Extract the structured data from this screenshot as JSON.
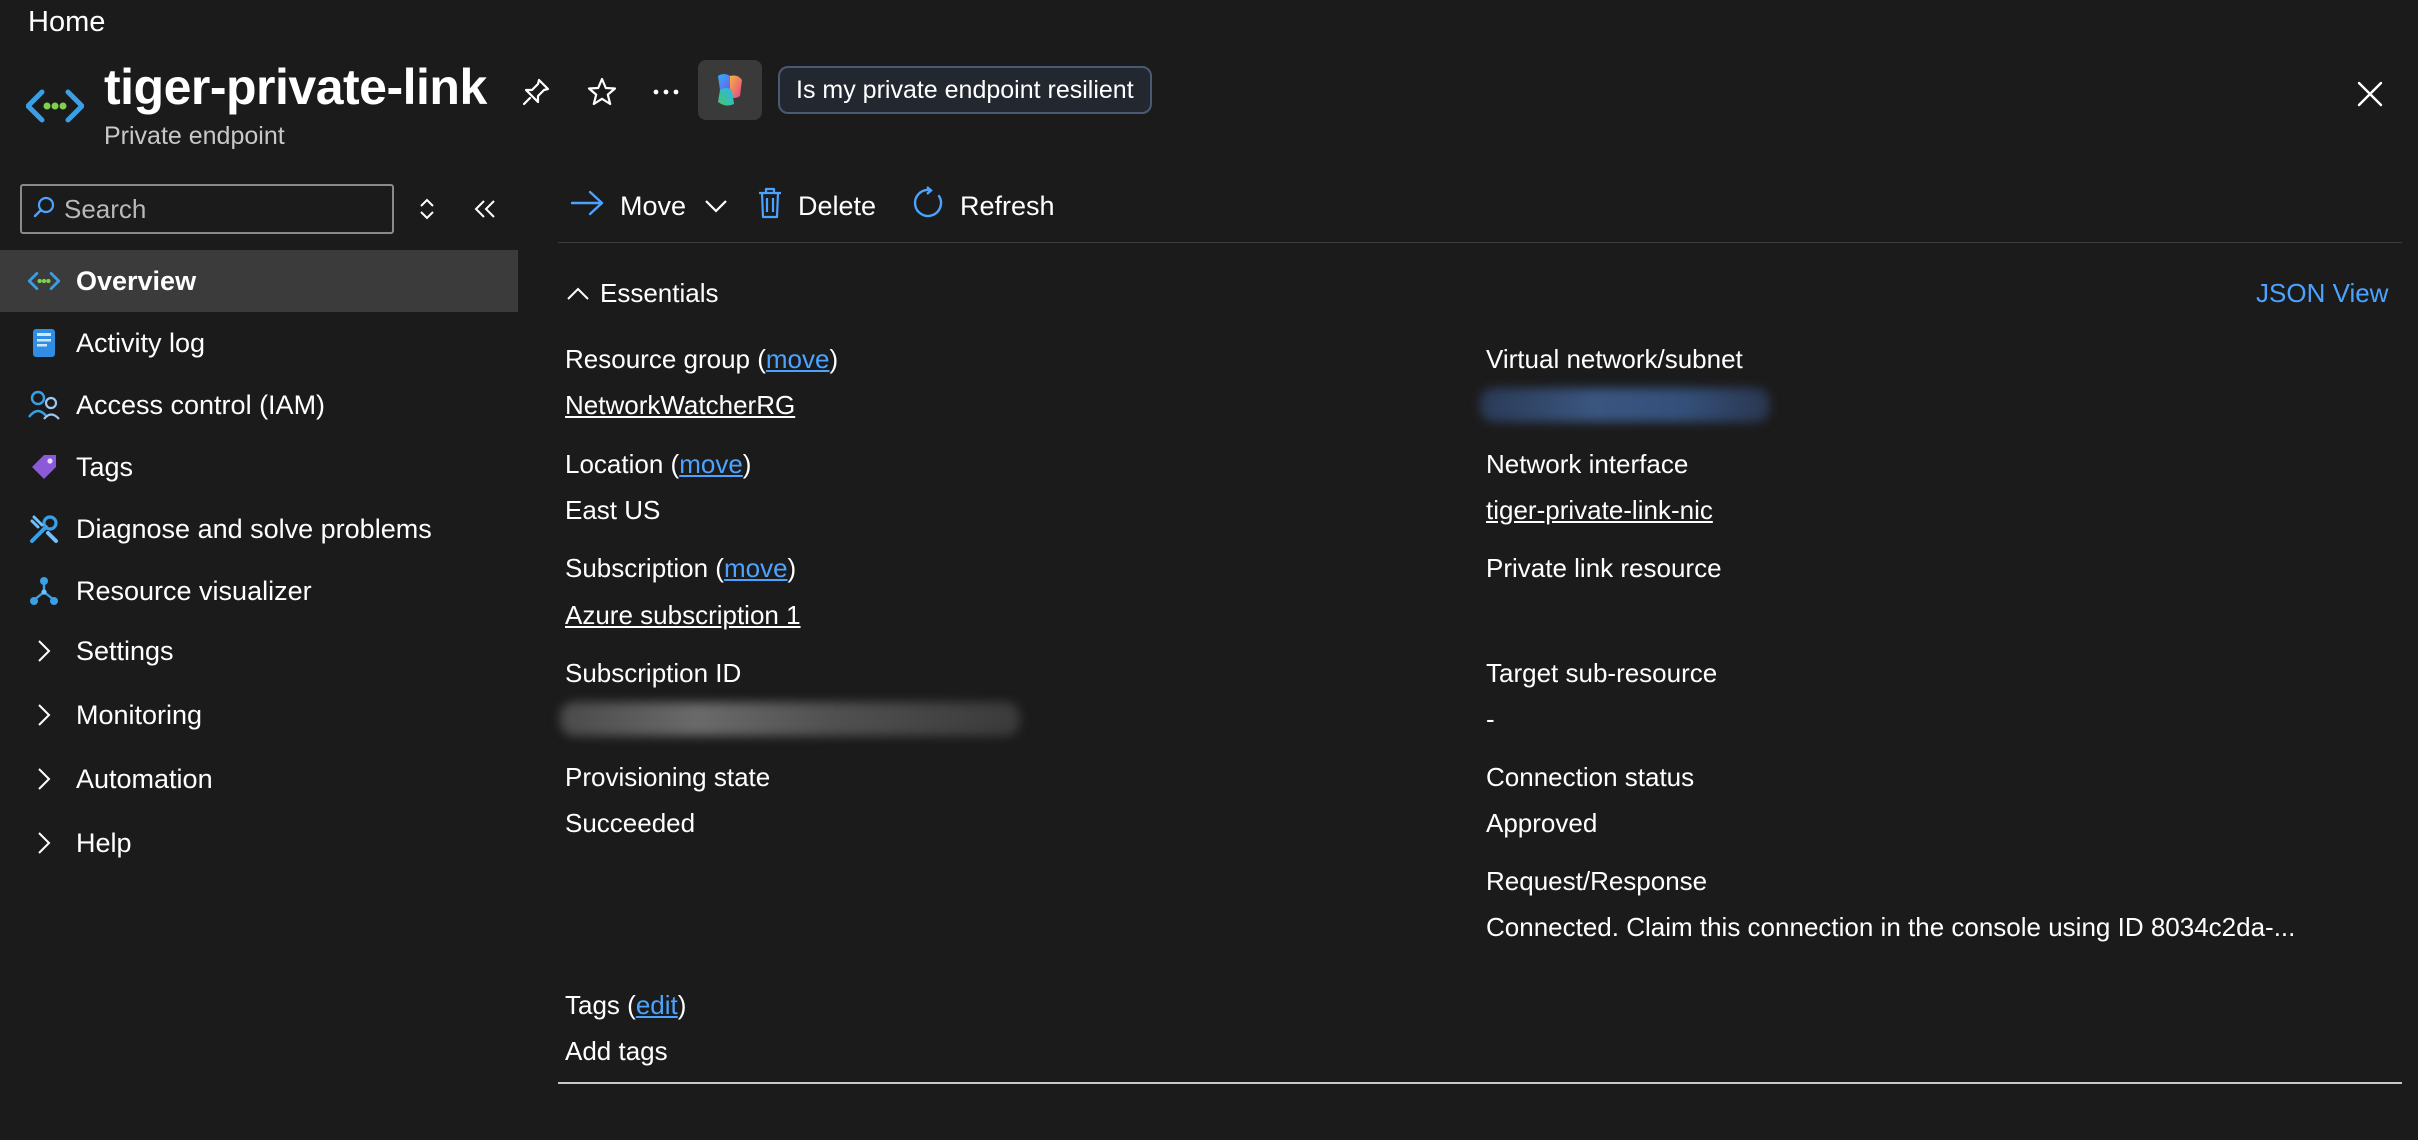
{
  "breadcrumb": "Home",
  "header": {
    "title": "tiger-private-link",
    "subtitle": "Private endpoint",
    "prompt_chip": "Is my private endpoint resilient"
  },
  "sidebar": {
    "search_placeholder": "Search",
    "items": [
      {
        "label": "Overview",
        "icon": "private-endpoint-icon",
        "active": true
      },
      {
        "label": "Activity log",
        "icon": "activity-log-icon"
      },
      {
        "label": "Access control (IAM)",
        "icon": "iam-icon"
      },
      {
        "label": "Tags",
        "icon": "tag-icon"
      },
      {
        "label": "Diagnose and solve problems",
        "icon": "wrench-icon"
      },
      {
        "label": "Resource visualizer",
        "icon": "visualizer-icon"
      },
      {
        "label": "Settings",
        "icon": "chevron-right-icon"
      },
      {
        "label": "Monitoring",
        "icon": "chevron-right-icon"
      },
      {
        "label": "Automation",
        "icon": "chevron-right-icon"
      },
      {
        "label": "Help",
        "icon": "chevron-right-icon"
      }
    ]
  },
  "toolbar": {
    "move": "Move",
    "delete": "Delete",
    "refresh": "Refresh"
  },
  "essentials": {
    "toggle_label": "Essentials",
    "json_view": "JSON View",
    "left": {
      "resource_group_label": "Resource group",
      "resource_group_move": "move",
      "resource_group_value": "NetworkWatcherRG",
      "location_label": "Location",
      "location_move": "move",
      "location_value": "East US",
      "subscription_label": "Subscription",
      "subscription_move": "move",
      "subscription_value": "Azure subscription 1",
      "subscription_id_label": "Subscription ID",
      "provisioning_state_label": "Provisioning state",
      "provisioning_state_value": "Succeeded"
    },
    "right": {
      "vnet_subnet_label": "Virtual network/subnet",
      "network_interface_label": "Network interface",
      "network_interface_value": "tiger-private-link-nic",
      "private_link_resource_label": "Private link resource",
      "target_sub_resource_label": "Target sub-resource",
      "target_sub_resource_value": "-",
      "connection_status_label": "Connection status",
      "connection_status_value": "Approved",
      "request_response_label": "Request/Response",
      "request_response_value": "Connected. Claim this connection in the console using ID 8034c2da-..."
    },
    "tags_label": "Tags",
    "tags_edit": "edit",
    "add_tags": "Add tags"
  },
  "colors": {
    "background": "#1b1b1b",
    "link": "#4ca3ff",
    "active_nav": "#3b3b3b"
  }
}
